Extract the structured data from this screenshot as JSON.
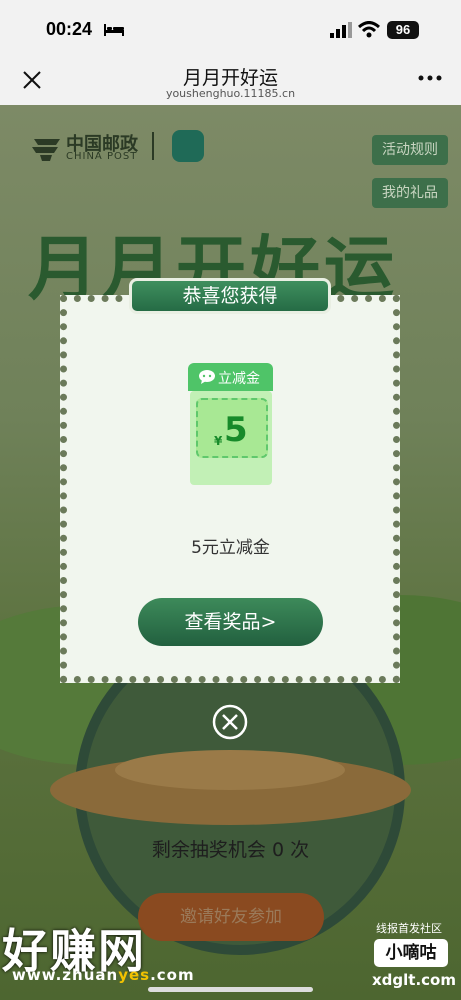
{
  "status_bar": {
    "time": "00:24",
    "battery": "96",
    "icons": [
      "bed-icon",
      "signal-icon",
      "wifi-icon",
      "battery-icon"
    ]
  },
  "nav": {
    "title": "月月开好运",
    "domain": "youshenghuo.11185.cn",
    "icons": [
      "close-icon",
      "more-icon"
    ]
  },
  "background_page": {
    "logo_cn": "中国邮政",
    "logo_en": "CHINA POST",
    "rules_button": "活动规则",
    "gifts_button": "我的礼品",
    "big_title": "月月开好运",
    "remaining_text": "剩余抽奖机会 0 次",
    "invite_button": "邀请好友参加"
  },
  "modal": {
    "header": "恭喜您获得",
    "coupon_tag": "立减金",
    "coupon_currency": "¥",
    "coupon_amount": "5",
    "prize_name": "5元立减金",
    "view_button": "查看奖品>"
  },
  "watermark": {
    "left_text": "好赚网",
    "left_url_prefix": "www.zhuan",
    "left_url_highlight": "yes",
    "left_url_suffix": ".com",
    "right_top": "线报首发社区",
    "right_box": "小嘀咕",
    "right_url": "xdglt.com"
  },
  "colors": {
    "modal_bg": "#f1f6ee",
    "header_green": "#2e7b4f",
    "coupon_green": "#4fc468",
    "button_green": "#2e6f4a"
  }
}
